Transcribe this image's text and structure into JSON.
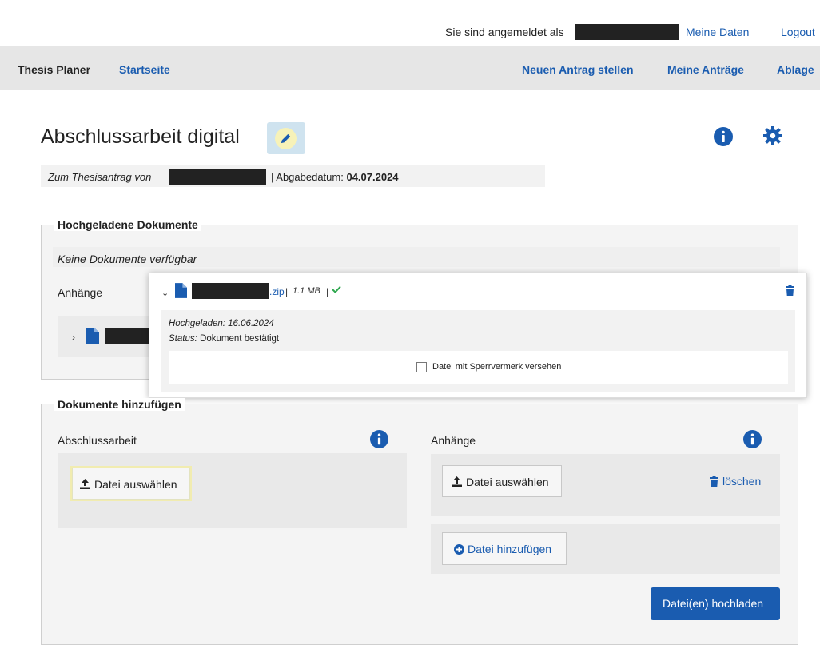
{
  "topbar": {
    "logged_in_label": "Sie sind angemeldet als",
    "meine_daten": "Meine Daten",
    "logout": "Logout"
  },
  "navbar": {
    "brand": "Thesis Planer",
    "startseite": "Startseite",
    "neuer_antrag": "Neuen Antrag stellen",
    "meine_antraege": "Meine Anträge",
    "ablage": "Ablage"
  },
  "page": {
    "title": "Abschlussarbeit digital",
    "ref_label": "Zum Thesisantrag von",
    "date_label": "| Abgabedatum:",
    "date_value": "04.07.2024"
  },
  "uploaded": {
    "legend": "Hochgeladene Dokumente",
    "empty_text": "Keine Dokumente verfügbar",
    "attachments_label": "Anhänge"
  },
  "popup": {
    "file_ext": ".zip",
    "sep1": "|",
    "file_size": "1.1 MB",
    "sep2": "|",
    "uploaded_line": "Hochgeladen: 16.06.2024",
    "status_label": "Status:",
    "status_value": "Dokument bestätigt",
    "checkbox_label": "Datei mit Sperrvermerk versehen"
  },
  "add_docs": {
    "legend": "Dokumente hinzufügen",
    "thesis_label": "Abschlussarbeit",
    "attachments_label": "Anhänge",
    "choose_file": "Datei auswählen",
    "choose_file_2": "Datei auswählen",
    "delete": "löschen",
    "add_file": "Datei hinzufügen",
    "upload": "Datei(en) hochladen"
  },
  "colors": {
    "accent": "#1a5cb0",
    "nav_bg": "#e6e6e6",
    "success": "#2fa84f"
  },
  "icons": [
    "pencil-icon",
    "info-icon",
    "gear-icon",
    "file-icon",
    "chevron-down-icon",
    "chevron-right-icon",
    "check-icon",
    "trash-icon",
    "upload-icon",
    "plus-circle-icon"
  ]
}
